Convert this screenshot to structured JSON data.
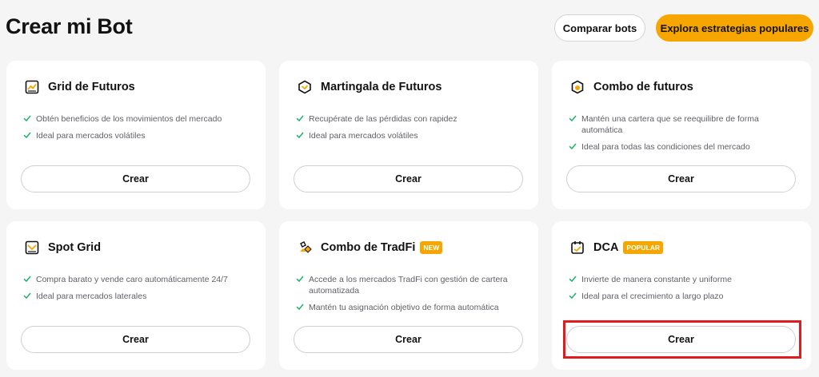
{
  "header": {
    "title": "Crear mi Bot",
    "compare_label": "Comparar bots",
    "explore_label": "Explora estrategias populares"
  },
  "colors": {
    "accent": "#f7a600",
    "check": "#20b26c",
    "highlight": "#e01c1c"
  },
  "cards": [
    {
      "title": "Grid de Futuros",
      "icon": "futures-grid-chart-icon",
      "badge": "",
      "features": [
        "Obtén beneficios de los movimientos del mercado",
        "Ideal para mercados volátiles"
      ],
      "button": "Crear"
    },
    {
      "title": "Martingala de Futuros",
      "icon": "martingale-cube-icon",
      "badge": "",
      "features": [
        "Recupérate de las pérdidas con rapidez",
        "Ideal para mercados volátiles"
      ],
      "button": "Crear"
    },
    {
      "title": "Combo de futuros",
      "icon": "combo-coin-icon",
      "badge": "",
      "features": [
        "Mantén una cartera que se reequilibre de forma automática",
        "Ideal para todas las condiciones del mercado"
      ],
      "button": "Crear"
    },
    {
      "title": "Spot Grid",
      "icon": "spot-grid-chart-icon",
      "badge": "",
      "features": [
        "Compra barato y vende caro automáticamente 24/7",
        "Ideal para mercados laterales"
      ],
      "button": "Crear"
    },
    {
      "title": "Combo de TradFi",
      "icon": "tradfi-gold-icon",
      "badge": "NEW",
      "features": [
        "Accede a los mercados TradFi con gestión de cartera automatizada",
        "Mantén tu asignación objetivo de forma automática"
      ],
      "button": "Crear"
    },
    {
      "title": "DCA",
      "icon": "dca-calendar-icon",
      "badge": "POPULAR",
      "features": [
        "Invierte de manera constante y uniforme",
        "Ideal para el crecimiento a largo plazo"
      ],
      "button": "Crear"
    }
  ]
}
